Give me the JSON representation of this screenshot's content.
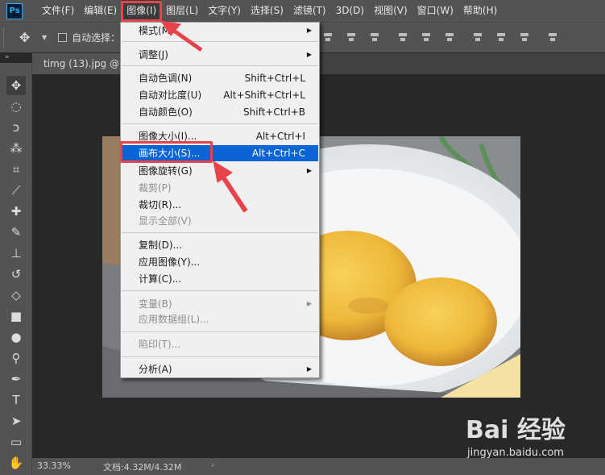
{
  "app": {
    "logo": "Ps"
  },
  "menubar": {
    "items": [
      {
        "label": "文件(F)"
      },
      {
        "label": "编辑(E)"
      },
      {
        "label": "图像(I)"
      },
      {
        "label": "图层(L)"
      },
      {
        "label": "文字(Y)"
      },
      {
        "label": "选择(S)"
      },
      {
        "label": "滤镜(T)"
      },
      {
        "label": "3D(D)"
      },
      {
        "label": "视图(V)"
      },
      {
        "label": "窗口(W)"
      },
      {
        "label": "帮助(H)"
      }
    ]
  },
  "options": {
    "auto_select_label": "自动选择："
  },
  "document": {
    "tab_title": "timg (13).jpg @ 3"
  },
  "status": {
    "zoom": "33.33%",
    "doc_size": "文档:4.32M/4.32M",
    "arrow": "›"
  },
  "image_menu": {
    "items": [
      {
        "label": "模式(M)",
        "shortcut": "",
        "submenu": true,
        "disabled": false
      },
      {
        "label": "调整(J)",
        "shortcut": "",
        "submenu": true,
        "disabled": false
      },
      {
        "label": "自动色调(N)",
        "shortcut": "Shift+Ctrl+L",
        "submenu": false,
        "disabled": false
      },
      {
        "label": "自动对比度(U)",
        "shortcut": "Alt+Shift+Ctrl+L",
        "submenu": false,
        "disabled": false
      },
      {
        "label": "自动颜色(O)",
        "shortcut": "Shift+Ctrl+B",
        "submenu": false,
        "disabled": false
      },
      {
        "label": "图像大小(I)...",
        "shortcut": "Alt+Ctrl+I",
        "submenu": false,
        "disabled": false
      },
      {
        "label": "画布大小(S)...",
        "shortcut": "Alt+Ctrl+C",
        "submenu": false,
        "disabled": false,
        "highlighted": true
      },
      {
        "label": "图像旋转(G)",
        "shortcut": "",
        "submenu": true,
        "disabled": false
      },
      {
        "label": "裁剪(P)",
        "shortcut": "",
        "submenu": false,
        "disabled": true
      },
      {
        "label": "裁切(R)...",
        "shortcut": "",
        "submenu": false,
        "disabled": false
      },
      {
        "label": "显示全部(V)",
        "shortcut": "",
        "submenu": false,
        "disabled": true
      },
      {
        "label": "复制(D)...",
        "shortcut": "",
        "submenu": false,
        "disabled": false
      },
      {
        "label": "应用图像(Y)...",
        "shortcut": "",
        "submenu": false,
        "disabled": false
      },
      {
        "label": "计算(C)...",
        "shortcut": "",
        "submenu": false,
        "disabled": false
      },
      {
        "label": "变量(B)",
        "shortcut": "",
        "submenu": true,
        "disabled": true
      },
      {
        "label": "应用数据组(L)...",
        "shortcut": "",
        "submenu": false,
        "disabled": true
      },
      {
        "label": "陷印(T)...",
        "shortcut": "",
        "submenu": false,
        "disabled": true
      },
      {
        "label": "分析(A)",
        "shortcut": "",
        "submenu": true,
        "disabled": false
      }
    ]
  },
  "watermark": {
    "brand": "Bai 经验",
    "url": "jingyan.baidu.com"
  },
  "colors": {
    "highlight": "#0a64d6",
    "annotation_red": "#e8434a",
    "menu_bg": "#f0f0f0",
    "chrome_bg": "#535353"
  },
  "icons": {
    "submenu_arrow": "▸",
    "toolbar": [
      "move",
      "marquee",
      "lasso",
      "quick-select",
      "crop",
      "eyedropper",
      "healing-brush",
      "brush",
      "clone-stamp",
      "history-brush",
      "eraser",
      "gradient",
      "blur",
      "dodge",
      "pen",
      "type",
      "path-select",
      "rectangle",
      "hand"
    ]
  }
}
